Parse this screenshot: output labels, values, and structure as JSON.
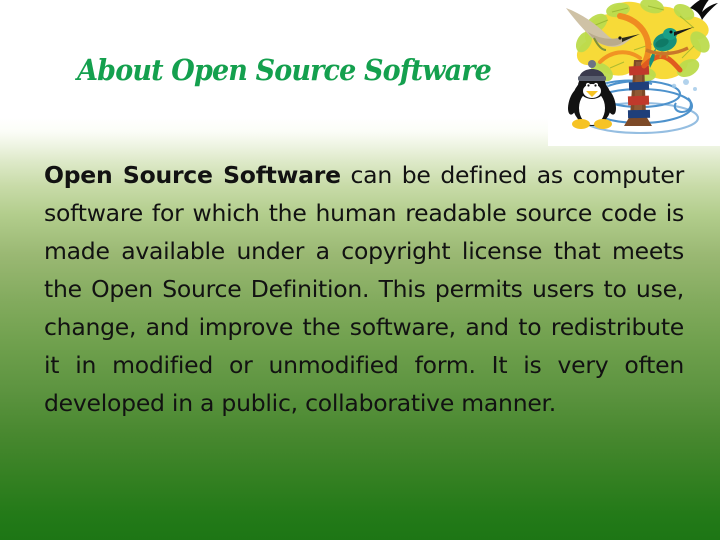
{
  "slide": {
    "title": "About Open Source Software",
    "title_color": "#14a04e",
    "background": {
      "top_color": "#ffffff",
      "mid_color": "#9ab873",
      "bottom_color": "#1d7615"
    },
    "body": {
      "lead": "Open Source Software",
      "rest": " can be defined as computer software for which the human readable source code is made available under a copyright license that meets the Open Source Definition. This permits users to use, change, and improve the software, and to redistribute it in modified or unmodified form. It is very often developed in a public, collaborative manner."
    },
    "illustration": {
      "name": "open-source-tree-illustration",
      "elements": [
        "yellow-leaf-tree",
        "flying-tern-bird",
        "kingfisher-bird",
        "linux-penguin-tux",
        "blue-water-swirl",
        "black-bird-silhouette"
      ],
      "leaf_color": "#f5d329",
      "leaf_accent_color": "#b9d94a",
      "trunk_color": "#7a4a2a",
      "swirl_color": "#2f7fc4",
      "kingfisher_color": "#16907a",
      "tux_body_color": "#101010",
      "tux_feet_color": "#f6c324"
    }
  }
}
